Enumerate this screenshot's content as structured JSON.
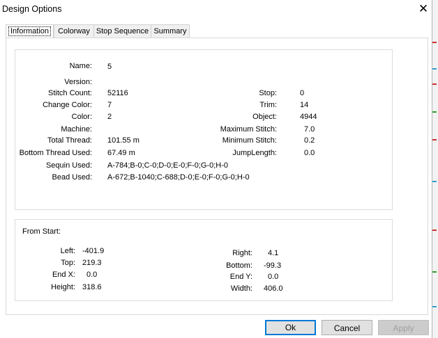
{
  "window": {
    "title": "Design Options",
    "close_symbol": "✕"
  },
  "tabs": [
    {
      "label": "Information"
    },
    {
      "label": "Colorway"
    },
    {
      "label": "Stop Sequence"
    },
    {
      "label": "Summary"
    }
  ],
  "info": {
    "name": {
      "label": "Name:",
      "value": "5"
    },
    "version": {
      "label": "Version:",
      "value": ""
    },
    "stitch_count": {
      "label": "Stitch Count:",
      "value": "52116"
    },
    "change_color": {
      "label": "Change Color:",
      "value": "7"
    },
    "color": {
      "label": "Color:",
      "value": "2"
    },
    "machine": {
      "label": "Machine:",
      "value": ""
    },
    "total_thread": {
      "label": "Total Thread:",
      "value": "101.55 m"
    },
    "bottom_thread_used": {
      "label": "Bottom Thread Used:",
      "value": "67.49 m"
    },
    "sequin_used": {
      "label": "Sequin Used:",
      "value": "A-784;B-0;C-0;D-0;E-0;F-0;G-0;H-0"
    },
    "bead_used": {
      "label": "Bead Used:",
      "value": "A-672;B-1040;C-688;D-0;E-0;F-0;G-0;H-0"
    },
    "stop": {
      "label": "Stop:",
      "value": "0"
    },
    "trim": {
      "label": "Trim:",
      "value": "14"
    },
    "object": {
      "label": "Object:",
      "value": "4944"
    },
    "maximum_stitch": {
      "label": "Maximum Stitch:",
      "value": "7.0"
    },
    "minimum_stitch": {
      "label": "Minimum Stitch:",
      "value": "0.2"
    },
    "jump_length": {
      "label": "JumpLength:",
      "value": "0.0"
    }
  },
  "from_start": {
    "title": "From Start:",
    "left": {
      "label": "Left:",
      "value": "-401.9"
    },
    "top": {
      "label": "Top:",
      "value": "219.3"
    },
    "end_x": {
      "label": "End X:",
      "value": "0.0"
    },
    "height": {
      "label": "Height:",
      "value": "318.6"
    },
    "right": {
      "label": "Right:",
      "value": "4.1"
    },
    "bottom": {
      "label": "Bottom:",
      "value": "-99.3"
    },
    "end_y": {
      "label": "End Y:",
      "value": "0.0"
    },
    "width": {
      "label": "Width:",
      "value": "406.0"
    }
  },
  "buttons": {
    "ok": "Ok",
    "cancel": "Cancel",
    "apply": "Apply"
  },
  "colors": {
    "accent": "#0078d7",
    "disabled_text": "#a0a0a0"
  }
}
